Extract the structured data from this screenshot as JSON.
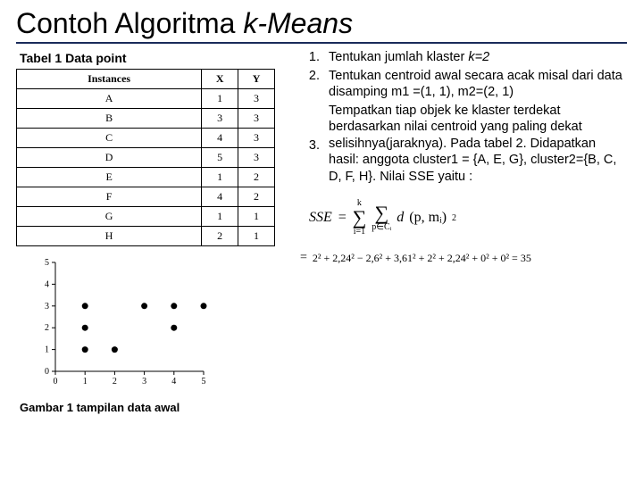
{
  "title_plain": "Contoh Algoritma ",
  "title_ital": "k-Means",
  "table_caption": "Tabel 1 Data point",
  "table": {
    "headers": [
      "Instances",
      "X",
      "Y"
    ],
    "rows": [
      [
        "A",
        "1",
        "3"
      ],
      [
        "B",
        "3",
        "3"
      ],
      [
        "C",
        "4",
        "3"
      ],
      [
        "D",
        "5",
        "3"
      ],
      [
        "E",
        "1",
        "2"
      ],
      [
        "F",
        "4",
        "2"
      ],
      [
        "G",
        "1",
        "1"
      ],
      [
        "H",
        "2",
        "1"
      ]
    ]
  },
  "fig_caption": "Gambar 1  tampilan data awal",
  "steps": {
    "n1": "1.",
    "n2": "2.",
    "n3": "3.",
    "t1a": "Tentukan jumlah klaster ",
    "t1b": "k=2",
    "t2": "Tentukan centroid awal secara acak misal dari data disamping m1 =(1, 1), m2=(2, 1)",
    "t3": "Tempatkan tiap objek ke klaster terdekat berdasarkan nilai centroid yang paling dekat selisihnya(jaraknya). Pada tabel 2. Didapatkan hasil: anggota cluster1 = {A, E, G}, cluster2={B, C, D, F, H}. Nilai SSE yaitu :"
  },
  "formula": {
    "lhs": "SSE",
    "eq": "=",
    "sum1_top": "k",
    "sum1_bot": "i=1",
    "sum2_top": "",
    "sum2_bot": "p∈Cᵢ",
    "d_open": "d",
    "d_args": "(p, mᵢ)",
    "sq": "2"
  },
  "sse_calc": {
    "eq": "=",
    "expr": "2² + 2,24² − 2,6² + 3,61² + 2² + 2,24² + 0² + 0² = 35",
    "result": ""
  },
  "chart_data": {
    "type": "scatter",
    "x": [
      1,
      3,
      4,
      5,
      1,
      4,
      1,
      2
    ],
    "y": [
      3,
      3,
      3,
      3,
      2,
      2,
      1,
      1
    ],
    "xlim": [
      0,
      5
    ],
    "ylim": [
      0,
      5
    ],
    "xticks": [
      0,
      1,
      2,
      3,
      4,
      5
    ],
    "yticks": [
      0,
      1,
      2,
      3,
      4,
      5
    ],
    "title": "",
    "xlabel": "",
    "ylabel": ""
  }
}
